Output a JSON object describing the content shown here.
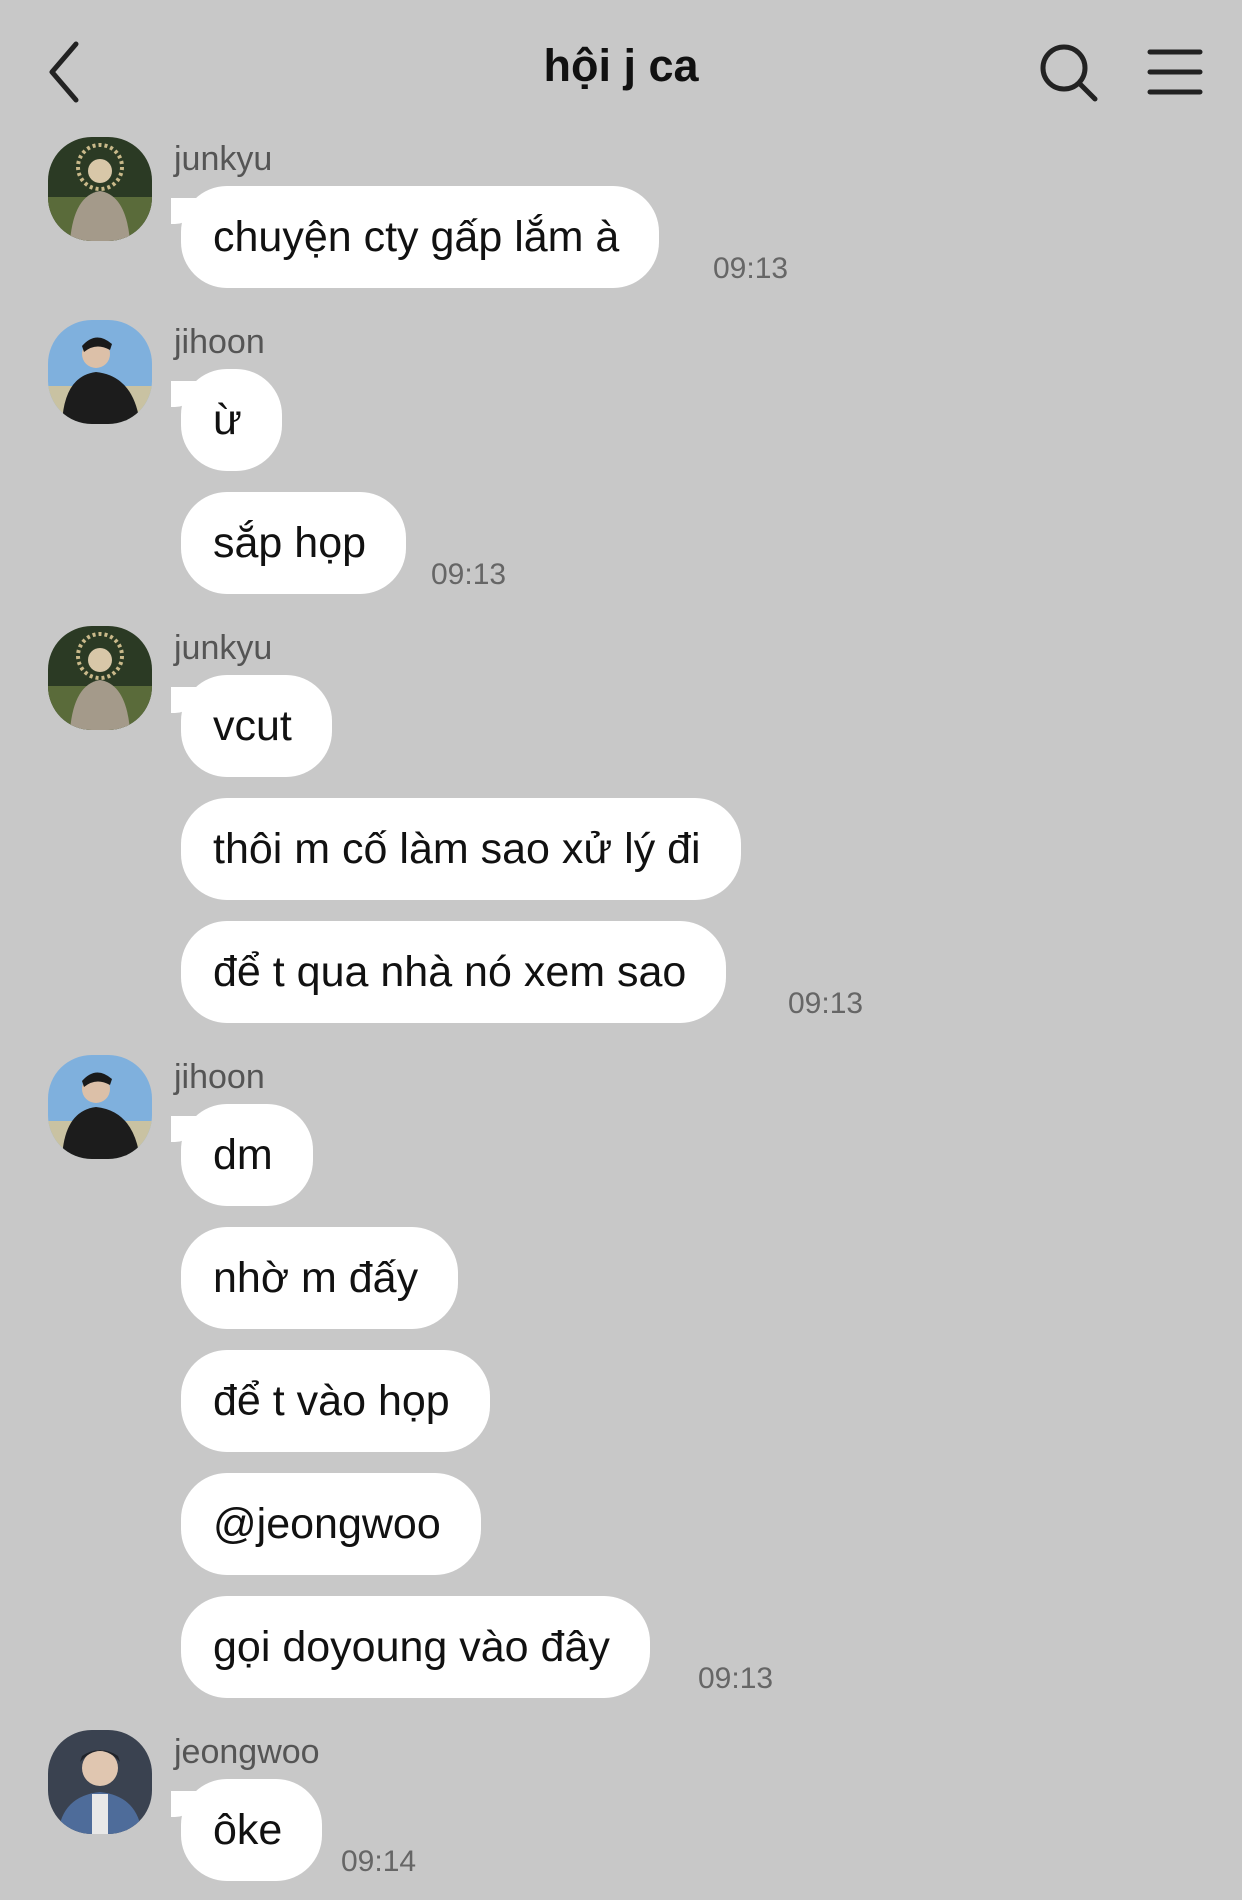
{
  "header": {
    "title": "hội j ca",
    "icons": [
      "back-chevron-icon",
      "search-icon",
      "menu-icon"
    ]
  },
  "messages": [
    {
      "sender": "junkyu",
      "avatar": "avatar-junkyu",
      "bubbles": [
        "chuyện cty gấp lắm à"
      ],
      "time": "09:13"
    },
    {
      "sender": "jihoon",
      "avatar": "avatar-jihoon",
      "bubbles": [
        "ừ",
        "sắp họp"
      ],
      "time": "09:13"
    },
    {
      "sender": "junkyu",
      "avatar": "avatar-junkyu",
      "bubbles": [
        "vcut",
        "thôi m cố làm sao xử lý đi",
        "để t qua nhà nó xem sao"
      ],
      "time": "09:13"
    },
    {
      "sender": "jihoon",
      "avatar": "avatar-jihoon",
      "bubbles": [
        "dm",
        "nhờ m đấy",
        "để t vào họp",
        "@jeongwoo",
        "gọi doyoung vào đây"
      ],
      "time": "09:13"
    },
    {
      "sender": "jeongwoo",
      "avatar": "avatar-jeongwoo",
      "bubbles": [
        "ôke"
      ],
      "time": "09:14"
    }
  ],
  "colors": {
    "background": "#c8c8c8",
    "bubble": "#ffffff",
    "text": "#111111",
    "sender": "#555555",
    "time": "#666666"
  }
}
